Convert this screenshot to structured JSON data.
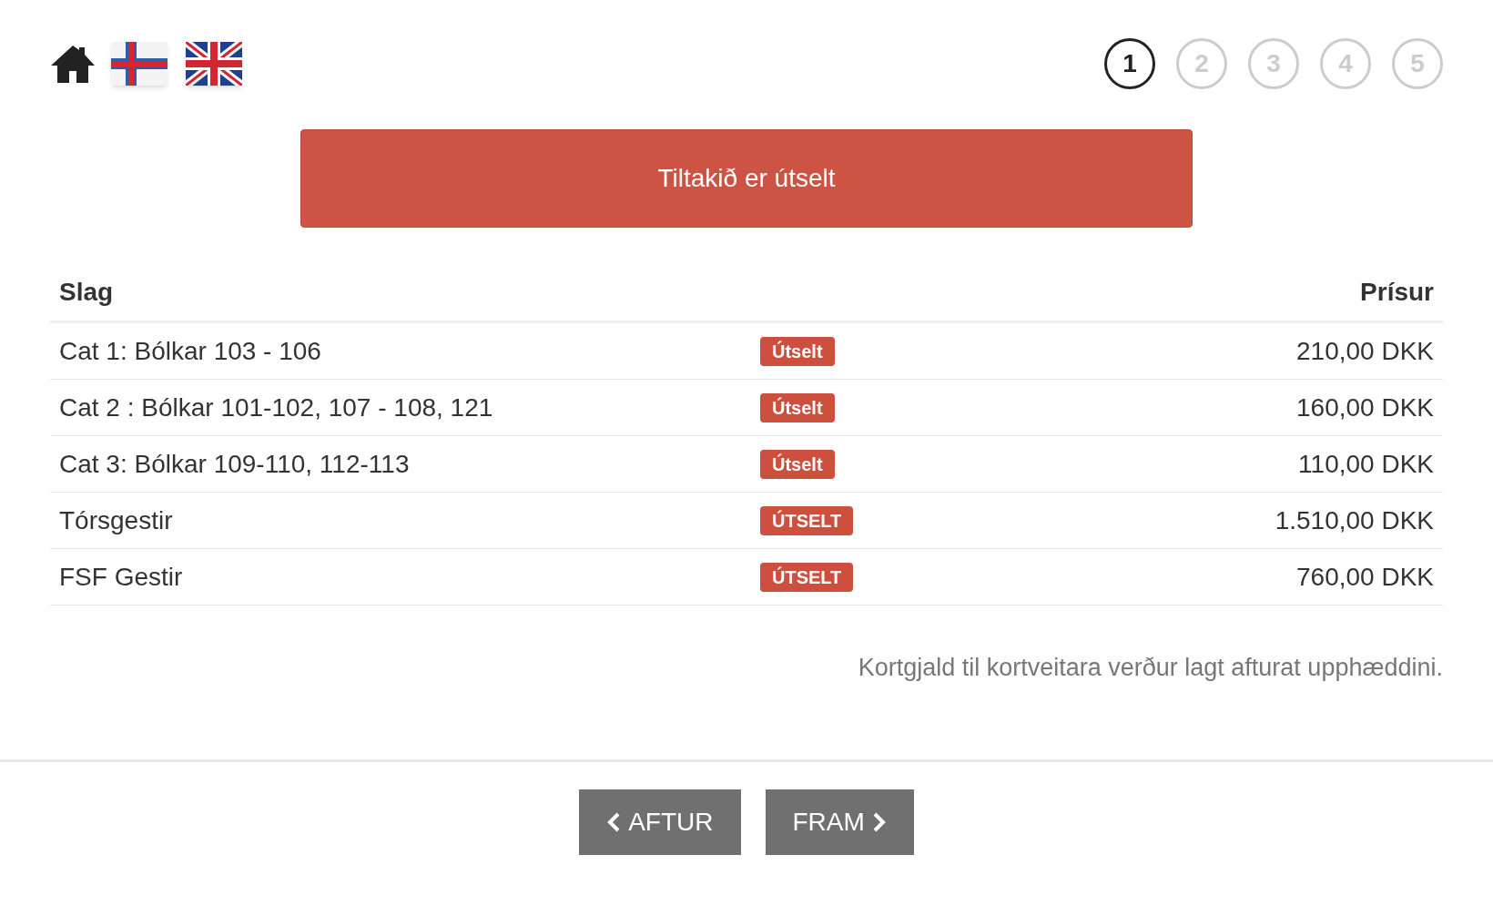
{
  "header": {
    "languages": [
      {
        "kind": "faroese"
      },
      {
        "kind": "english"
      }
    ],
    "steps": [
      {
        "label": "1",
        "selected": true
      },
      {
        "label": "2",
        "selected": false
      },
      {
        "label": "3",
        "selected": false
      },
      {
        "label": "4",
        "selected": false
      },
      {
        "label": "5",
        "selected": false
      }
    ]
  },
  "alert": "Tiltakið er útselt",
  "table": {
    "columns": [
      "Slag",
      "Prísur"
    ],
    "rows": [
      {
        "name": "Cat 1: Bólkar 103 - 106",
        "badge": "Útselt",
        "price": "210,00 DKK"
      },
      {
        "name": "Cat 2 : Bólkar 101-102, 107 - 108, 121",
        "badge": "Útselt",
        "price": "160,00 DKK"
      },
      {
        "name": "Cat 3: Bólkar 109-110, 112-113",
        "badge": "Útselt",
        "price": "110,00 DKK"
      },
      {
        "name": "Tórsgestir",
        "badge": "ÚTSELT",
        "price": "1.510,00 DKK"
      },
      {
        "name": "FSF Gestir",
        "badge": "ÚTSELT",
        "price": "760,00 DKK"
      }
    ]
  },
  "note": "Kortgjald til kortveitara verður lagt afturat upphæddini.",
  "buttons": {
    "back": "AFTUR",
    "next": "FRAM"
  }
}
